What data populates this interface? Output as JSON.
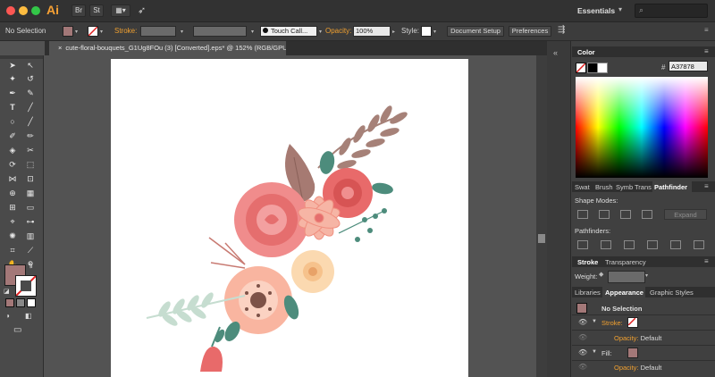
{
  "app": {
    "logo": "Ai",
    "workspace": "Essentials",
    "br_label": "Br",
    "st_label": "St"
  },
  "colors": {
    "accent": "#f0a030",
    "fill": "#a37878",
    "canvas": "#ffffff",
    "ui_bg": "#535353"
  },
  "control_bar": {
    "selection_label": "No Selection",
    "stroke_label": "Stroke:",
    "brush_label": "Touch Call...",
    "opacity_label": "Opacity:",
    "opacity_value": "100%",
    "style_label": "Style:",
    "document_setup": "Document Setup",
    "preferences": "Preferences"
  },
  "document_tab": {
    "title": "cute-floral-bouquets_G1Ug8FOu (3) [Converted].eps* @ 152% (RGB/GPU Preview)",
    "close": "×"
  },
  "color_panel": {
    "title": "Color",
    "hex_symbol": "#",
    "hex_value": "A37878"
  },
  "panel_tabs": {
    "swatches": "Swat",
    "brushes": "Brush",
    "symbols": "Symb",
    "transform": "Trans",
    "pathfinder": "Pathfinder"
  },
  "pathfinder": {
    "shape_modes": "Shape Modes:",
    "expand": "Expand",
    "pathfinders": "Pathfinders:"
  },
  "stroke_panel": {
    "stroke_tab": "Stroke",
    "transparency_tab": "Transparency",
    "weight_label": "Weight:"
  },
  "appearance_tabs": {
    "libraries": "Libraries",
    "appearance": "Appearance",
    "graphic_styles": "Graphic Styles"
  },
  "appearance": {
    "no_selection": "No Selection",
    "stroke_label": "Stroke:",
    "opacity_label": "Opacity:",
    "opacity_value": "Default",
    "fill_label": "Fill:",
    "fill_opacity_label": "Opacity:",
    "fill_opacity_value": "Default"
  },
  "icons": [
    "close-dot-icon",
    "minimize-dot-icon",
    "zoom-dot-icon",
    "bridge-icon",
    "stock-icon",
    "arrange-documents-icon",
    "gpu-rocket-icon",
    "search-icon",
    "selection-tool-icon",
    "direct-selection-tool-icon",
    "pen-tool-icon",
    "type-tool-icon",
    "rectangle-tool-icon",
    "paintbrush-tool-icon",
    "rotate-tool-icon",
    "hand-tool-icon",
    "zoom-tool-icon",
    "eye-icon"
  ]
}
